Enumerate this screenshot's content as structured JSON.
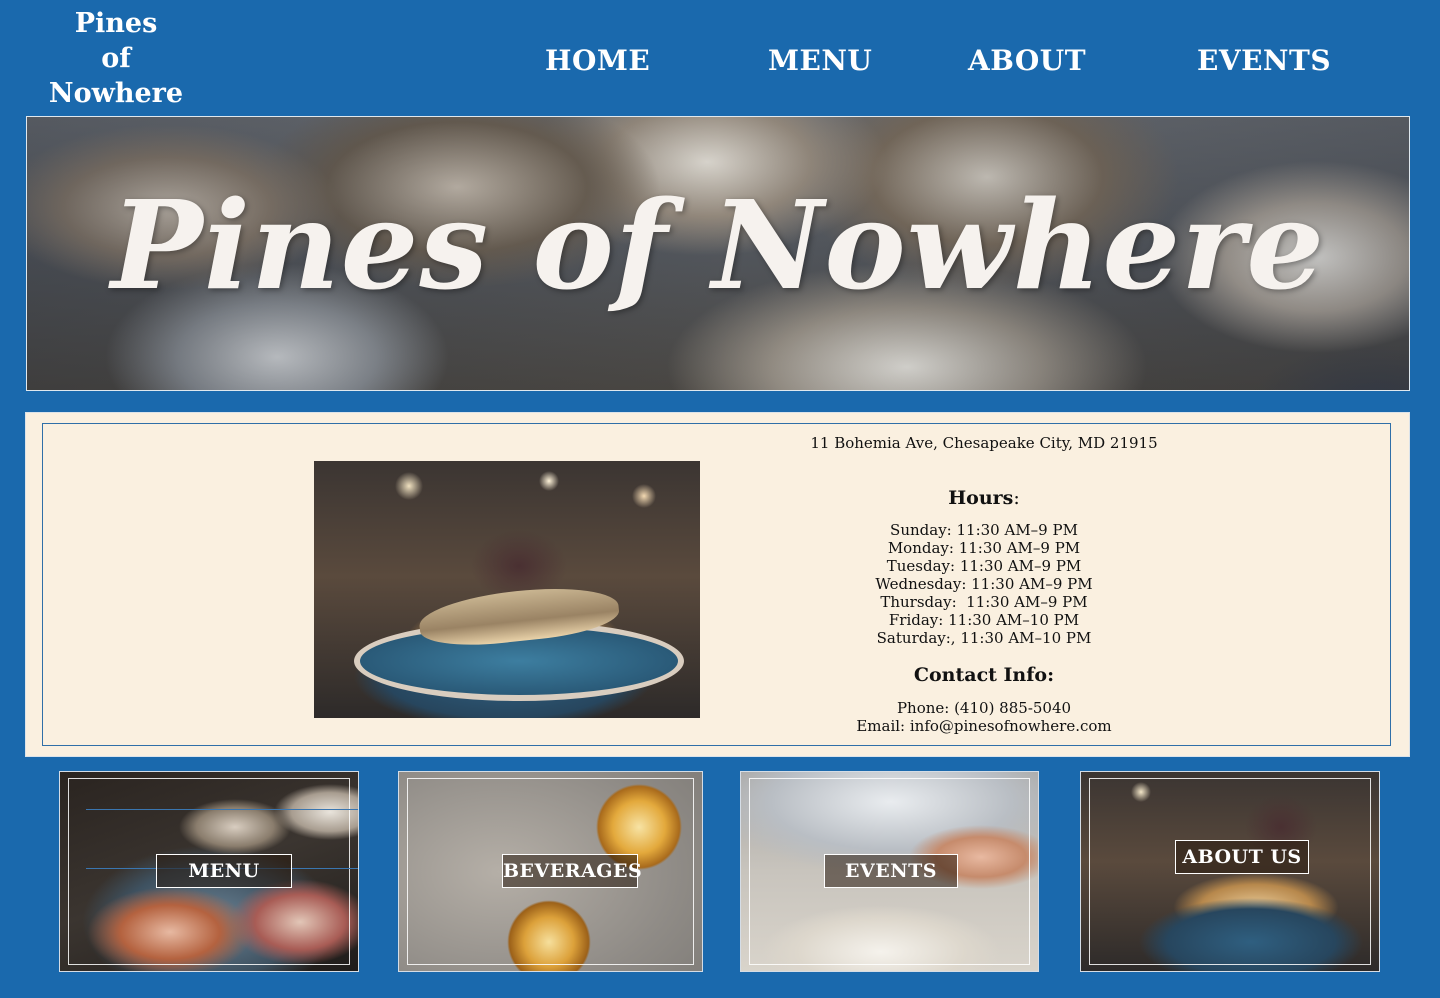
{
  "logo": {
    "line1": "Pines",
    "line2": "of",
    "line3": "Nowhere"
  },
  "nav": {
    "home": "HOME",
    "menu": "MENU",
    "about": "ABOUT",
    "events": "EVENTS"
  },
  "hero": {
    "title": "Pines of Nowhere"
  },
  "info": {
    "address": "11 Bohemia Ave, Chesapeake City, MD 21915",
    "hours_heading_bold": "Hours",
    "hours_heading_suffix": ":",
    "hours": [
      "Sunday: 11:30 AM–9 PM",
      "Monday: 11:30 AM–9 PM",
      "Tuesday: 11:30 AM–9 PM",
      "Wednesday: 11:30 AM–9 PM",
      "Thursday:  11:30 AM–9 PM",
      "Friday: 11:30 AM–10 PM",
      "Saturday:, 11:30 AM–10 PM"
    ],
    "contact_heading": "Contact Info:",
    "phone": "Phone: (410) 885-5040",
    "email": "Email: info@pinesofnowhere.com"
  },
  "tiles": {
    "menu": "MENU",
    "beverages": "BEVERAGES",
    "events": "EVENTS",
    "about": "ABOUT US"
  },
  "colors": {
    "background": "#1a69ad",
    "panel": "#faf0e0",
    "panel_border": "#2f6fa8",
    "text_light": "#ffffff"
  }
}
